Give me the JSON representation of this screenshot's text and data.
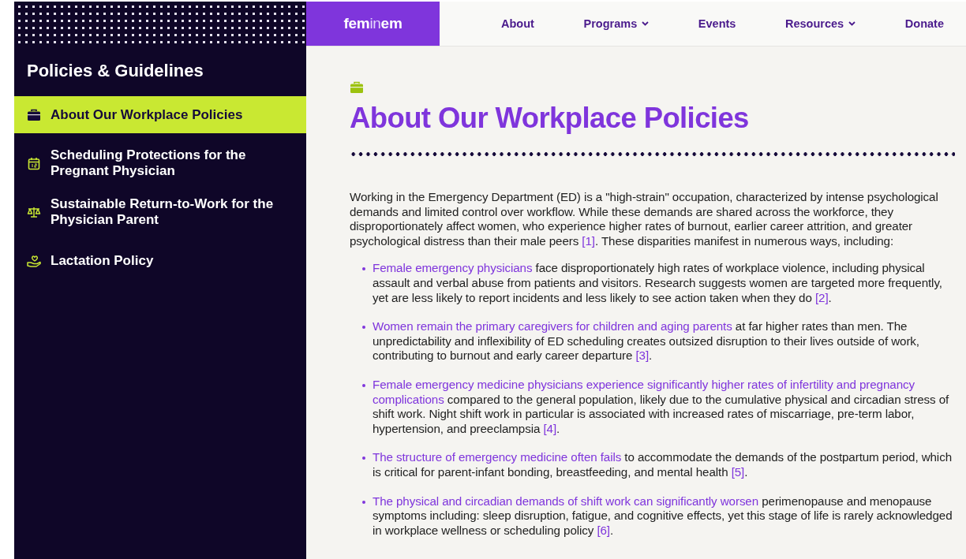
{
  "sidebar": {
    "title": "Policies & Guidelines",
    "items": [
      {
        "label": "About Our Workplace Policies",
        "selected": true
      },
      {
        "label": "Scheduling Protections for the Pregnant Physician",
        "selected": false
      },
      {
        "label": "Sustainable Return-to-Work for the Physician Parent",
        "selected": false
      },
      {
        "label": "Lactation Policy",
        "selected": false
      }
    ]
  },
  "logo": {
    "bold_start": "fem",
    "light_middle": "in",
    "bold_end": "em"
  },
  "nav": [
    {
      "label": "About",
      "dropdown": false
    },
    {
      "label": "Programs",
      "dropdown": true
    },
    {
      "label": "Events",
      "dropdown": false
    },
    {
      "label": "Resources",
      "dropdown": true
    },
    {
      "label": "Donate",
      "dropdown": false
    }
  ],
  "page": {
    "title": "About Our Workplace Policies",
    "intro": [
      {
        "text": "Working in the Emergency Department (ED) is a \"high-strain\" occupation, characterized by intense psychological demands and limited control over workflow. While these demands are shared across the workforce, they disproportionately affect women, who experience higher rates of burnout, earlier career attrition, and greater psychological distress than their male peers "
      },
      {
        "cite": "[1]"
      },
      {
        "text": ". These disparities manifest in numerous ways, including:"
      }
    ],
    "bullets": [
      {
        "lead": "Female emergency physicians",
        "body": [
          {
            "text": " face disproportionately high rates of workplace violence, including physical assault and verbal abuse from patients and visitors. Research suggests women are targeted more frequently, yet are less likely to report incidents and less likely to see action taken when they do "
          },
          {
            "cite": "[2]"
          },
          {
            "text": "."
          }
        ]
      },
      {
        "lead": "Women remain the primary caregivers for children and aging parents",
        "body": [
          {
            "text": " at far higher rates than men. The unpredictability and inflexibility of ED scheduling creates outsized disruption to their lives outside of work, contributing to burnout and early career departure "
          },
          {
            "cite": "[3]"
          },
          {
            "text": "."
          }
        ]
      },
      {
        "lead": "Female emergency medicine physicians experience significantly higher rates of infertility and pregnancy complications",
        "body": [
          {
            "text": " compared to the general population, likely due to the cumulative physical and circadian stress of shift work. Night shift work in particular is associated with increased rates of miscarriage, pre-term labor, hypertension, and preeclampsia "
          },
          {
            "cite": "[4]"
          },
          {
            "text": "."
          }
        ]
      },
      {
        "lead": "The structure of emergency medicine often fails",
        "body": [
          {
            "text": " to accommodate the demands of the postpartum period, which is critical for parent-infant bonding, breastfeeding, and mental health "
          },
          {
            "cite": "[5]"
          },
          {
            "text": "."
          }
        ]
      },
      {
        "lead": "The physical and circadian demands of shift work can significantly worsen",
        "body": [
          {
            "text": " perimenopause and menopause symptoms including: sleep disruption, fatigue, and cognitive effects, yet this stage of life is rarely acknowledged in workplace wellness or scheduling policy "
          },
          {
            "cite": "[6]"
          },
          {
            "text": "."
          }
        ]
      }
    ]
  }
}
